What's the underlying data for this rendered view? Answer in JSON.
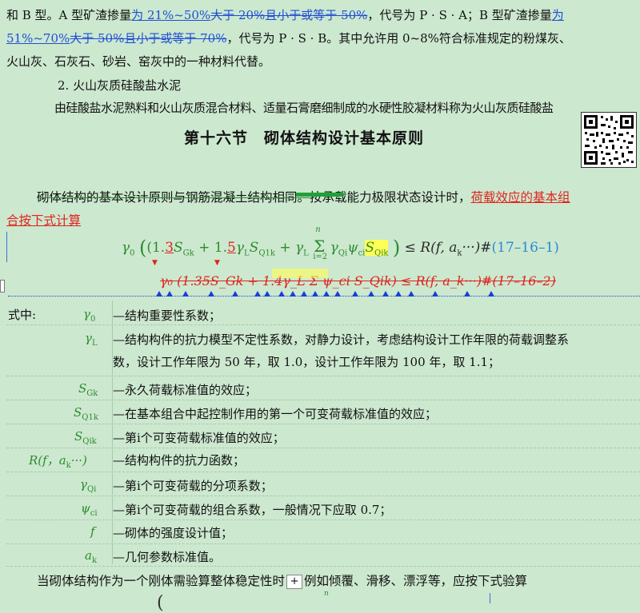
{
  "top_para": {
    "l1_a": "和 B 型。A 型矿渣掺量",
    "l1_ins": "为 21%~50%",
    "l1_del": "大于 20%且小于或等于 50%",
    "l1_b": "，代号为 P · S · A；B 型矿渣掺量",
    "l1_ins2": "为",
    "l2_ins": "51%~70%",
    "l2_del": "大于 50%且小于或等于 70%",
    "l2_b": "，代号为 P · S · B。其中允许用 0~8%符合标准规定的粉煤灰、",
    "l3": "火山灰、石灰石、砂岩、窑灰中的一种材料代替。"
  },
  "sub_heading": "2. 火山灰质硅酸盐水泥",
  "sub_para": "由硅酸盐水泥熟料和火山灰质混合材料、适量石膏磨细制成的水硬性胶凝材料称为火山灰质硅酸盐",
  "section_title": "第十六节　砌体结构设计基本原则",
  "intro": {
    "a": "砌体结构的基本设计原则与钢筋混凝土结构相同。",
    "b": "按承载能力极限状态设计时，",
    "c": "荷载效应的基本组",
    "d": "合按下式计算"
  },
  "formula1": {
    "g0": "γ",
    "open": "(1.",
    "c1": "3",
    "s1": "S",
    "s1sub": "Gk",
    "plus1": " + 1.",
    "c2": "5",
    "gL": "γ",
    "gLsub": "L",
    "s2": "S",
    "s2sub": "Q1k",
    "plus2": " + γ",
    "plus2sub": "L",
    "sum_top": "n",
    "sum_bot": "i=2",
    "tail": "γ",
    "tail2": "ψ",
    "tail3": "S",
    "rhs": ") ≤ R(f, a",
    "rhs_sub": "k",
    "rhs2": "···)#",
    "num": "(17–16–1)"
  },
  "formula2": "γ₀ (1.35S_Gk + 1.4γ_L Σ ψ_ci S_Qik) ≤ R(f, a_k···)#(17–16–2)",
  "where_label": "式中:",
  "defs": [
    {
      "sym": "γ₀",
      "text": "—结构重要性系数；"
    },
    {
      "sym": "γ_L",
      "text": "—结构构件的抗力模型不定性系数，对静力设计，考虑结构设计工作年限的荷载调整系"
    },
    {
      "sym": "",
      "text": "数，设计工作年限为 50 年，取 1.0，设计工作年限为 100 年，取 1.1；"
    },
    {
      "sym": "S_Gk",
      "text": "—永久荷载标准值的效应；"
    },
    {
      "sym": "S_Q1k",
      "text": "—在基本组合中起控制作用的第一个可变荷载标准值的效应；"
    },
    {
      "sym": "S_Qik",
      "text": "—第i个可变荷载标准值的效应；"
    },
    {
      "sym": "R(f，a_k···)",
      "text": "—结构构件的抗力函数；"
    },
    {
      "sym": "γ_Qi",
      "text": "—第i个可变荷载的分项系数；"
    },
    {
      "sym": "ψ_ci",
      "text": "—第i个可变荷载的组合系数，一般情况下应取 0.7；"
    },
    {
      "sym": "f",
      "text": "—砌体的强度设计值；"
    },
    {
      "sym": "a_k",
      "text": "—几何参数标准值。"
    }
  ],
  "closing": {
    "a": "当砌体结构作为一个刚体需验算整体稳定性时",
    "plus": "+",
    "b": "例如倾覆、滑移、漂浮等，应按下式验算"
  },
  "bottom_sum_top": "n",
  "colors": {
    "bg": "#cce8cf",
    "ins": "#1f4fd6",
    "del_red": "#e0231e",
    "math": "#2e8b2e"
  }
}
